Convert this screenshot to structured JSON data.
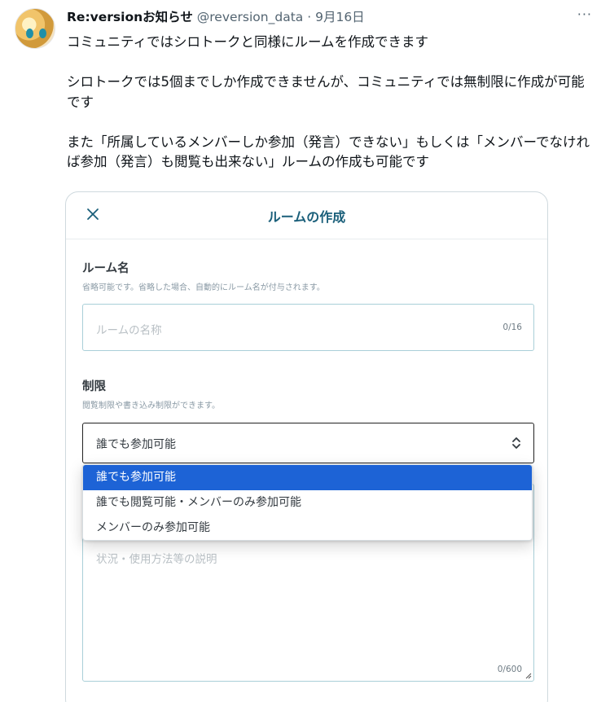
{
  "tweet": {
    "display_name": "Re:versionお知らせ",
    "handle": "@reversion_data",
    "separator": "·",
    "date": "9月16日",
    "more_label": "···",
    "text": "コミュニティではシロトークと同様にルームを作成できます\n\nシロトークでは5個までしか作成できませんが、コミュニティでは無制限に作成が可能です\n\nまた「所属しているメンバーしか参加（発言）できない」もしくは「メンバーでなければ参加（発言）も閲覧も出来ない」ルームの作成も可能です"
  },
  "dialog": {
    "title": "ルームの作成",
    "room_name": {
      "label": "ルーム名",
      "help": "省略可能です。省略した場合、自動的にルーム名が付与されます。",
      "placeholder": "ルームの名称",
      "counter": "0/16"
    },
    "restriction": {
      "label": "制限",
      "help": "閲覧制限や書き込み制限ができます。",
      "selected": "誰でも参加可能",
      "options": [
        "誰でも参加可能",
        "誰でも閲覧可能・メンバーのみ参加可能",
        "メンバーのみ参加可能"
      ]
    },
    "description": {
      "placeholder": "状況・使用方法等の説明",
      "counter": "0/600"
    }
  },
  "colors": {
    "title_text": "#1a5f7a",
    "selected_option_bg": "#1d63d6",
    "input_border": "#a9cfd8"
  }
}
